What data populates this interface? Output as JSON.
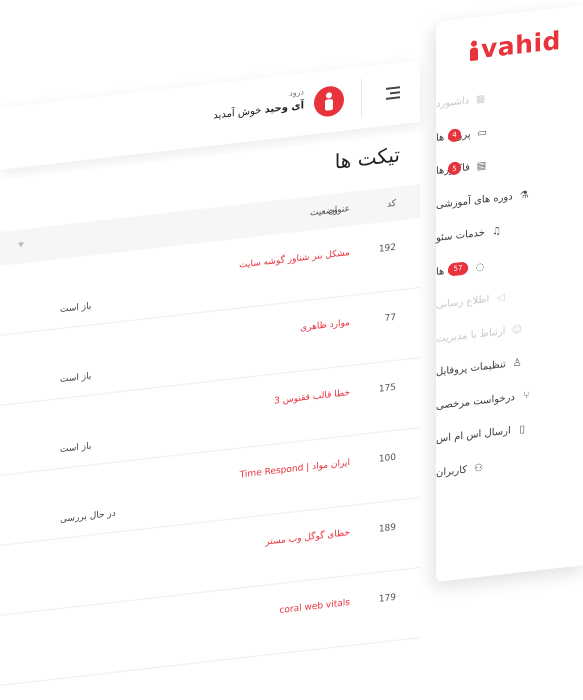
{
  "brand": {
    "logo_text": "vahid",
    "accent": "#e8323c"
  },
  "sidebar": {
    "items": [
      {
        "label": "داشبورد",
        "icon": "grid-icon",
        "disabled": true,
        "badge": ""
      },
      {
        "label": "پروژه ها",
        "icon": "folder-icon",
        "disabled": false,
        "badge": "4"
      },
      {
        "label": "فاکتورها",
        "icon": "invoice-icon",
        "disabled": false,
        "badge": "5"
      },
      {
        "label": "دوره های آموزشی",
        "icon": "flask-icon",
        "disabled": false,
        "badge": ""
      },
      {
        "label": "خدمات سئو",
        "icon": "bell-icon",
        "disabled": false,
        "badge": ""
      },
      {
        "label": "تیکت ها",
        "icon": "chat-icon",
        "disabled": false,
        "badge": "57"
      },
      {
        "label": "اطلاع رسانی",
        "icon": "megaphone-icon",
        "disabled": true,
        "badge": ""
      },
      {
        "label": "ارتباط با مدیریت",
        "icon": "smile-icon",
        "disabled": true,
        "badge": ""
      },
      {
        "label": "تنظیمات پروفایل",
        "icon": "user-icon",
        "disabled": false,
        "badge": ""
      },
      {
        "label": "درخواست مرخصی",
        "icon": "branch-icon",
        "disabled": false,
        "badge": ""
      },
      {
        "label": "ارسال اس ام اس",
        "icon": "phone-icon",
        "disabled": false,
        "badge": ""
      },
      {
        "label": "کاربران",
        "icon": "users-icon",
        "disabled": false,
        "badge": ""
      }
    ]
  },
  "header": {
    "greeting": "درود",
    "user_name": "آی وحید",
    "welcome": "خوش آمدید"
  },
  "page": {
    "title": "تیکت ها"
  },
  "table": {
    "columns": {
      "id": "کد",
      "title": "عنوان",
      "status": "وضعیت"
    },
    "rows": [
      {
        "id": "192",
        "title": "مشکل بنر شناور گوشه سایت",
        "status": "باز است"
      },
      {
        "id": "77",
        "title": "موارد ظاهری",
        "status": "باز است"
      },
      {
        "id": "175",
        "title": "خطا قالب ققنوس 3",
        "status": "باز است"
      },
      {
        "id": "100",
        "title": "ایران مواد | Time Respond",
        "status": "در حال بررسی"
      },
      {
        "id": "189",
        "title": "خطای گوگل وب مستر",
        "status": ""
      },
      {
        "id": "179",
        "title": "coral web vitals",
        "status": ""
      }
    ]
  }
}
